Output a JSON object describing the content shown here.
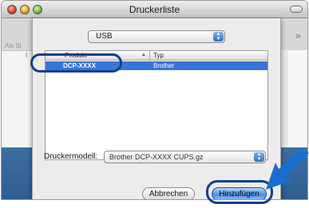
{
  "window": {
    "title": "Druckerliste"
  },
  "background": {
    "label": "Als St",
    "column_letter": "I",
    "chevron": "»"
  },
  "connection_popup": {
    "selected": "USB"
  },
  "printer_table": {
    "columns": [
      "Produkt",
      "Typ"
    ],
    "rows": [
      {
        "produkt": "DCP-XXXX",
        "typ": "Brother"
      }
    ]
  },
  "model": {
    "label": "Druckermodell:",
    "selected": "Brother DCP-XXXX CUPS.gz"
  },
  "buttons": {
    "cancel": "Abbrechen",
    "add": "Hinzufügen"
  },
  "colors": {
    "selection": "#3875d7",
    "highlight_outline": "#0e3f8c",
    "arrow": "#1a6ecf"
  }
}
